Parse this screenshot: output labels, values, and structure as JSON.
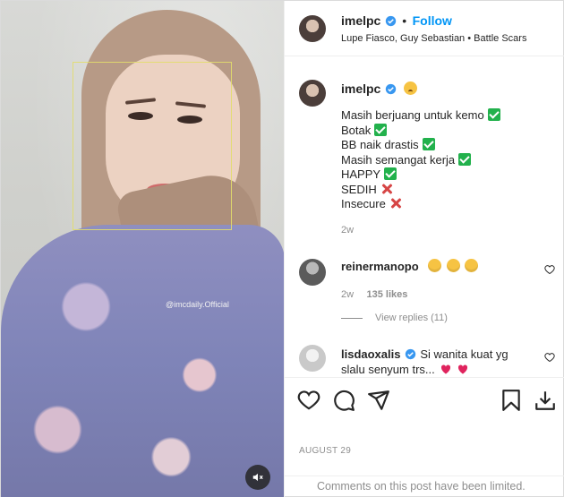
{
  "media": {
    "watermark": "@imcdaily.Official"
  },
  "header": {
    "username": "imelpc",
    "follow_label": "Follow",
    "song": "Lupe Fiasco, Guy Sebastian • Battle Scars"
  },
  "caption": {
    "username": "imelpc",
    "lines": [
      {
        "text": "Masih berjuang untuk kemo",
        "mark": "check"
      },
      {
        "text": "Botak",
        "mark": "check"
      },
      {
        "text": "BB naik drastis",
        "mark": "check"
      },
      {
        "text": "Masih semangat kerja",
        "mark": "check"
      },
      {
        "text": "HAPPY",
        "mark": "check"
      },
      {
        "text": "SEDIH",
        "mark": "cross"
      },
      {
        "text": "Insecure",
        "mark": "cross"
      }
    ],
    "time": "2w"
  },
  "comments": [
    {
      "username": "reinermanopo",
      "time": "2w",
      "likes": "135 likes",
      "view_replies": "View replies (11)"
    },
    {
      "username": "lisdaoxalis",
      "text_line1": "Si wanita kuat yg",
      "text_line2": "slalu senyum trs..."
    }
  ],
  "footer": {
    "date": "AUGUST 29",
    "limited_notice": "Comments on this post have been limited."
  },
  "colors": {
    "link_blue": "#0095f6",
    "verified_blue": "#3897f0",
    "check_green": "#22b14c",
    "cross_red": "#d64545",
    "text_gray": "#8e8e8e"
  }
}
